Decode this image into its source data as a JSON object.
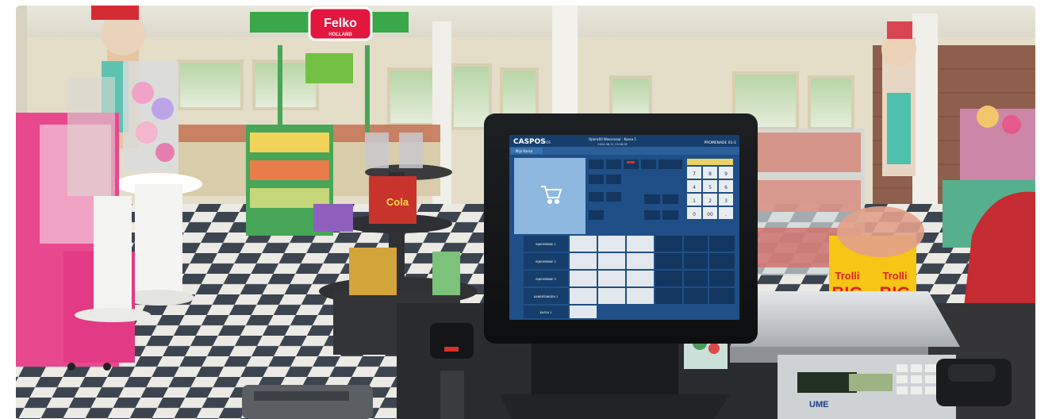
{
  "photo": {
    "sign_brand": "Felko",
    "sign_brand_sub": "HOLLAND",
    "cola_label": "Cola",
    "trolli_left_brand": "Trolli",
    "trolli_left_word": "BIG",
    "trolli_right_brand": "Trolli",
    "trolli_right_word": "BIG",
    "scale_brand": "UME",
    "colors": {
      "floor_dark": "#3c4450",
      "floor_light": "#eceae4",
      "pink_cabinet": "#e8488e",
      "pos_screen": "#1f4f86",
      "pos_bezel": "#141618",
      "sign_red": "#e3173e",
      "sign_green": "#3aa64a",
      "trolli_yellow": "#f6c515",
      "trolli_red": "#e41e26"
    }
  },
  "pos": {
    "brand": "CASPOS",
    "brand_suffix": "POS",
    "header_center": "Openstill Wassenaar · Kassa 1",
    "header_date": "2024-06-11 13:08:16",
    "header_right": "PROMENADE 01-1",
    "tab": "Mijn Kassa",
    "keypad": [
      "7",
      "8",
      "9",
      "4",
      "5",
      "6",
      "1",
      "2",
      "3",
      "0",
      "00",
      "."
    ],
    "left_buttons": [
      "BIJKOMENDE 1",
      "BIJKOMENDE 2",
      "BIJKOMENDE 3",
      "AANBIEDINGEN 1",
      "KASSA 1"
    ]
  }
}
